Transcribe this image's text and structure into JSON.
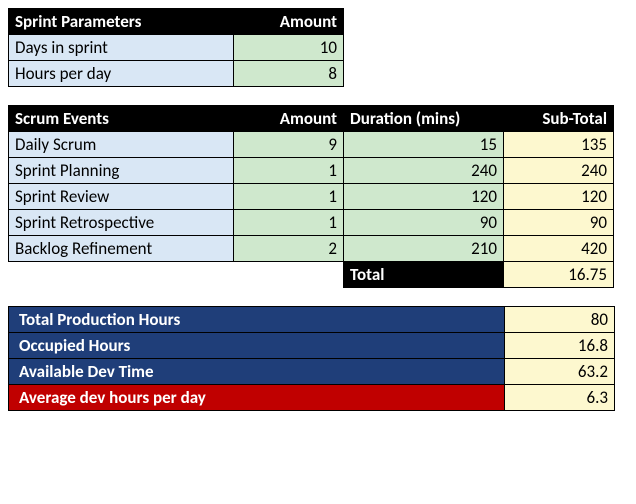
{
  "sprint": {
    "headers": [
      "Sprint Parameters",
      "Amount"
    ],
    "rows": [
      {
        "label": "Days in sprint",
        "amount": 10
      },
      {
        "label": "Hours per day",
        "amount": 8
      }
    ]
  },
  "events": {
    "headers": [
      "Scrum Events",
      "Amount",
      "Duration (mins)",
      "Sub-Total"
    ],
    "rows": [
      {
        "label": "Daily Scrum",
        "amount": 9,
        "duration": 15,
        "subtotal": 135
      },
      {
        "label": "Sprint Planning",
        "amount": 1,
        "duration": 240,
        "subtotal": 240
      },
      {
        "label": "Sprint Review",
        "amount": 1,
        "duration": 120,
        "subtotal": 120
      },
      {
        "label": "Sprint Retrospective",
        "amount": 1,
        "duration": 90,
        "subtotal": 90
      },
      {
        "label": "Backlog Refinement",
        "amount": 2,
        "duration": 210,
        "subtotal": 420
      }
    ],
    "total_label": "Total",
    "total_value": 16.75
  },
  "summary": {
    "rows": [
      {
        "label": "Total Production Hours",
        "value": 80,
        "style": "navy"
      },
      {
        "label": "Occupied Hours",
        "value": 16.8,
        "style": "navy"
      },
      {
        "label": "Available Dev Time",
        "value": 63.2,
        "style": "navy"
      },
      {
        "label": "Average dev hours per day",
        "value": 6.3,
        "style": "red"
      }
    ]
  }
}
